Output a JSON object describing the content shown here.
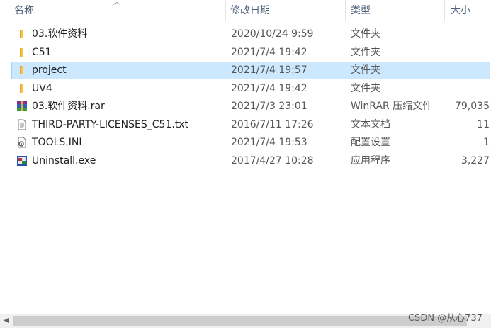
{
  "columns": {
    "name": "名称",
    "date": "修改日期",
    "type": "类型",
    "size": "大小"
  },
  "files": [
    {
      "name": "03.软件资料",
      "date": "2020/10/24 9:59",
      "type": "文件夹",
      "size": "",
      "icon": "folder-icon"
    },
    {
      "name": "C51",
      "date": "2021/7/4 19:42",
      "type": "文件夹",
      "size": "",
      "icon": "folder-icon"
    },
    {
      "name": "project",
      "date": "2021/7/4 19:57",
      "type": "文件夹",
      "size": "",
      "icon": "folder-icon",
      "selected": true
    },
    {
      "name": "UV4",
      "date": "2021/7/4 19:42",
      "type": "文件夹",
      "size": "",
      "icon": "folder-icon"
    },
    {
      "name": "03.软件资料.rar",
      "date": "2021/7/3 23:01",
      "type": "WinRAR 压缩文件",
      "size": "79,035",
      "icon": "winrar-archive-icon"
    },
    {
      "name": "THIRD-PARTY-LICENSES_C51.txt",
      "date": "2016/7/11 17:26",
      "type": "文本文档",
      "size": "11",
      "icon": "text-document-icon"
    },
    {
      "name": "TOOLS.INI",
      "date": "2021/7/4 19:53",
      "type": "配置设置",
      "size": "1",
      "icon": "ini-config-icon"
    },
    {
      "name": "Uninstall.exe",
      "date": "2017/4/27 10:28",
      "type": "应用程序",
      "size": "3,227",
      "icon": "application-exe-icon"
    }
  ],
  "watermark": "CSDN @从心737",
  "colors": {
    "selection": "#cce8ff",
    "selection_border": "#99d1ff",
    "header_text": "#4c607a",
    "folder": "#f8c54a"
  }
}
